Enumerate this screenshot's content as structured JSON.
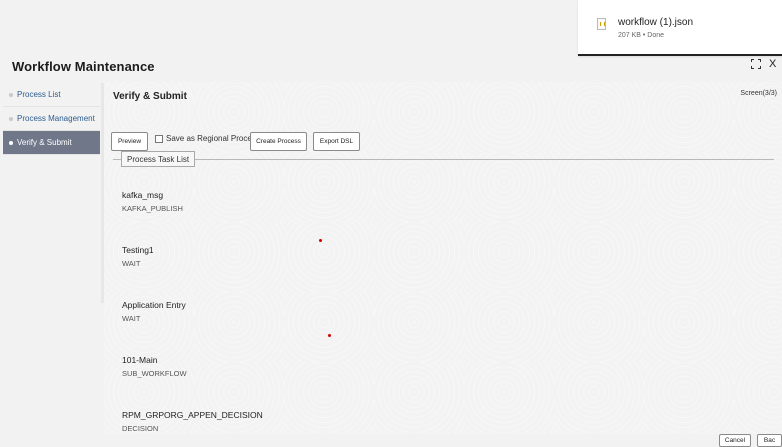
{
  "download": {
    "file_name": "workflow (1).json",
    "status": "207 KB • Done"
  },
  "header": {
    "title": "Workflow Maintenance",
    "close_glyph": "X"
  },
  "sidebar": {
    "items": [
      {
        "label": "Process List",
        "active": false
      },
      {
        "label": "Process Management",
        "active": false
      },
      {
        "label": "Verify & Submit",
        "active": true
      }
    ]
  },
  "main": {
    "title": "Verify & Submit",
    "screen_indicator": "Screen(3/3)",
    "buttons": {
      "preview": "Preview",
      "regional_checkbox_label": "Save as Regional Process",
      "regional_checked": false,
      "create_process": "Create Process",
      "export_dsl": "Export DSL"
    },
    "task_list_legend": "Process Task List",
    "tasks": [
      {
        "name": "kafka_msg",
        "type": "KAFKA_PUBLISH"
      },
      {
        "name": "Testing1",
        "type": "WAIT"
      },
      {
        "name": "Application Entry",
        "type": "WAIT"
      },
      {
        "name": "101-Main",
        "type": "SUB_WORKFLOW"
      },
      {
        "name": "RPM_GRPORG_APPEN_DECISION",
        "type": "DECISION"
      }
    ]
  },
  "footer": {
    "cancel": "Cancel",
    "back": "Bac"
  },
  "colors": {
    "active_sidebar": "#6f7789",
    "link": "#2c5d8f",
    "marker": "#d40000"
  }
}
